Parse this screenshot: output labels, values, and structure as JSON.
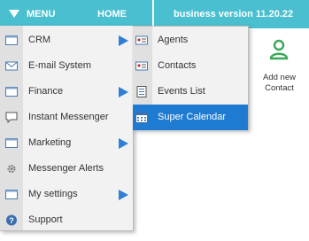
{
  "topbar": {
    "menu_label": "MENU",
    "home_label": "HOME",
    "version": "business version 11.20.22"
  },
  "quick_add": {
    "line1": "Add new",
    "line2": "Contact",
    "icon": "user-add-icon"
  },
  "menu": {
    "items": [
      {
        "label": "CRM",
        "icon": "folder-icon",
        "has_submenu": true
      },
      {
        "label": "E-mail System",
        "icon": "envelope-icon",
        "has_submenu": false
      },
      {
        "label": "Finance",
        "icon": "folder-icon",
        "has_submenu": true
      },
      {
        "label": "Instant Messenger",
        "icon": "speech-bubble-icon",
        "has_submenu": false
      },
      {
        "label": "Marketing",
        "icon": "folder-icon",
        "has_submenu": true
      },
      {
        "label": "Messenger Alerts",
        "icon": "gear-icon",
        "has_submenu": false
      },
      {
        "label": "My settings",
        "icon": "folder-icon",
        "has_submenu": true
      },
      {
        "label": "Support",
        "icon": "help-icon",
        "has_submenu": false
      }
    ]
  },
  "submenu": {
    "items": [
      {
        "label": "Agents",
        "icon": "id-card-icon"
      },
      {
        "label": "Contacts",
        "icon": "id-card-icon"
      },
      {
        "label": "Events List",
        "icon": "list-icon"
      },
      {
        "label": "Super Calendar",
        "icon": "calendar-icon",
        "active": true
      }
    ]
  },
  "colors": {
    "header": "#49bfcf",
    "arrow": "#2f7fd6",
    "active": "#1f7bd1",
    "user_icon": "#3aa85b"
  }
}
